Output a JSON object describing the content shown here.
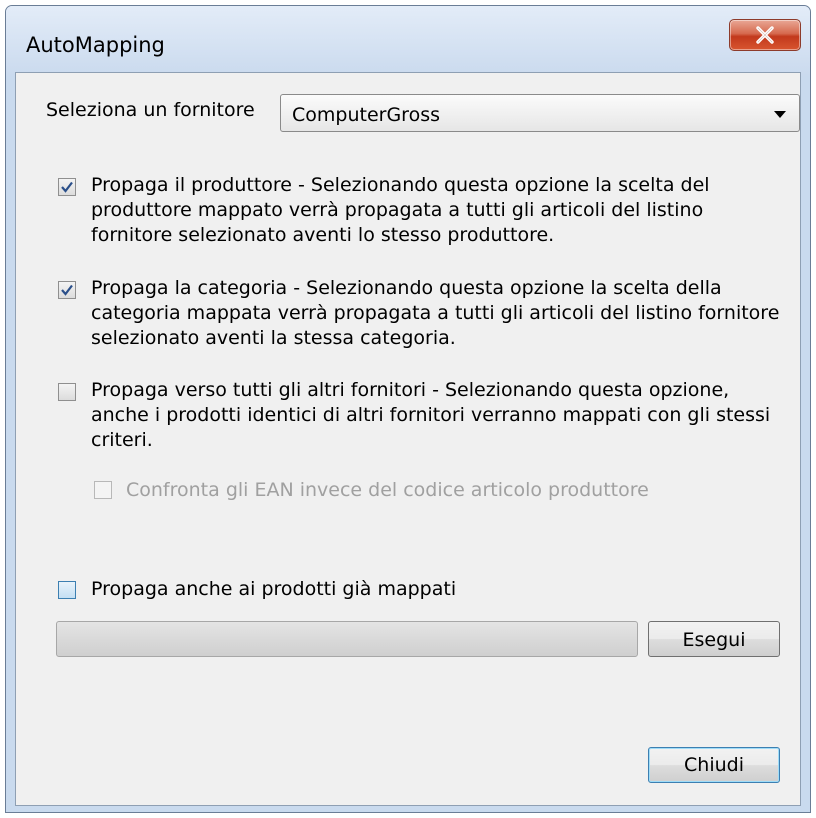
{
  "window": {
    "title": "AutoMapping",
    "close_icon": "close-icon"
  },
  "supplier": {
    "label": "Seleziona un fornitore",
    "selected": "ComputerGross"
  },
  "options": [
    {
      "checked": true,
      "lines": [
        "Propaga il produttore - Selezionando questa opzione la scelta del",
        "produttore mappato verrà propagata a tutti gli articoli del listino",
        "fornitore selezionato aventi lo stesso produttore."
      ]
    },
    {
      "checked": true,
      "lines": [
        "Propaga la categoria - Selezionando questa opzione la scelta della",
        "categoria mappata verrà propagata a tutti gli articoli del listino fornitore",
        "selezionato aventi la stessa categoria."
      ]
    },
    {
      "checked": false,
      "lines": [
        "Propaga verso tutti gli altri fornitori - Selezionando questa opzione,",
        "anche i prodotti identici di altri fornitori verranno mappati con gli stessi",
        "criteri."
      ]
    }
  ],
  "ean_option": {
    "checked": false,
    "enabled": false,
    "label": "Confronta gli EAN invece del codice articolo produttore"
  },
  "already_mapped_option": {
    "checked": false,
    "label": "Propaga anche ai prodotti già mappati"
  },
  "progress": {
    "value": 0
  },
  "buttons": {
    "run": "Esegui",
    "close": "Chiudi"
  }
}
